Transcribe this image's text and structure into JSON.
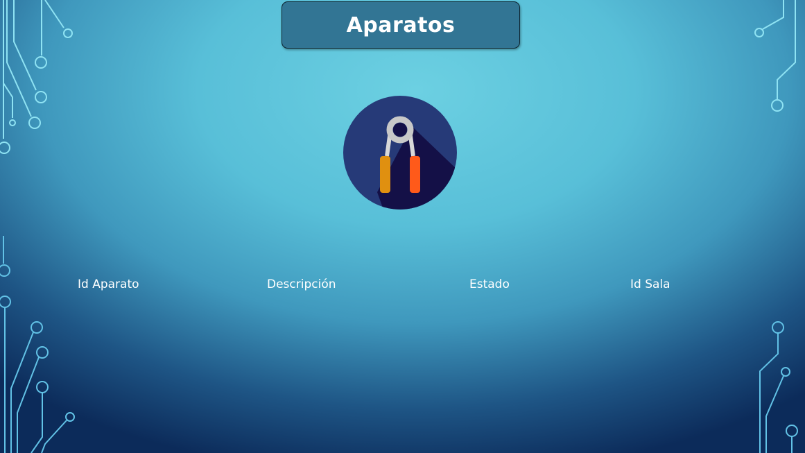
{
  "slide": {
    "title": "Aparatos",
    "icon": "hand-grip-icon",
    "columns": [
      "Id Aparato",
      "Descripción",
      "Estado",
      "Id Sala"
    ]
  },
  "colors": {
    "title_box": "#327594",
    "icon_circle": "#263a78",
    "icon_shadow": "#141047",
    "handle_left": "#e09010",
    "handle_right": "#ff5a1a"
  }
}
